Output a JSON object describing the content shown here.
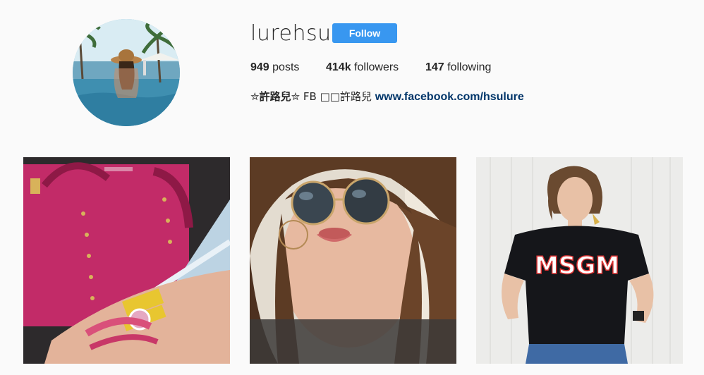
{
  "profile": {
    "username": "lurehsu",
    "follow_label": "Follow",
    "stats": {
      "posts_count": "949",
      "posts_label": "posts",
      "followers_count": "414k",
      "followers_label": "followers",
      "following_count": "147",
      "following_label": "following"
    },
    "bio": {
      "name": "✮許路兒✮",
      "text": " FB □□許路兒 ",
      "link": "www.facebook.com/hsulure"
    }
  },
  "posts": [
    {
      "subject": "pink-handbag-bracelets"
    },
    {
      "subject": "sunglasses-selfie"
    },
    {
      "subject": "msgm-tshirt"
    }
  ],
  "colors": {
    "follow_button": "#3897f0",
    "link": "#003569",
    "background": "#fafafa"
  }
}
